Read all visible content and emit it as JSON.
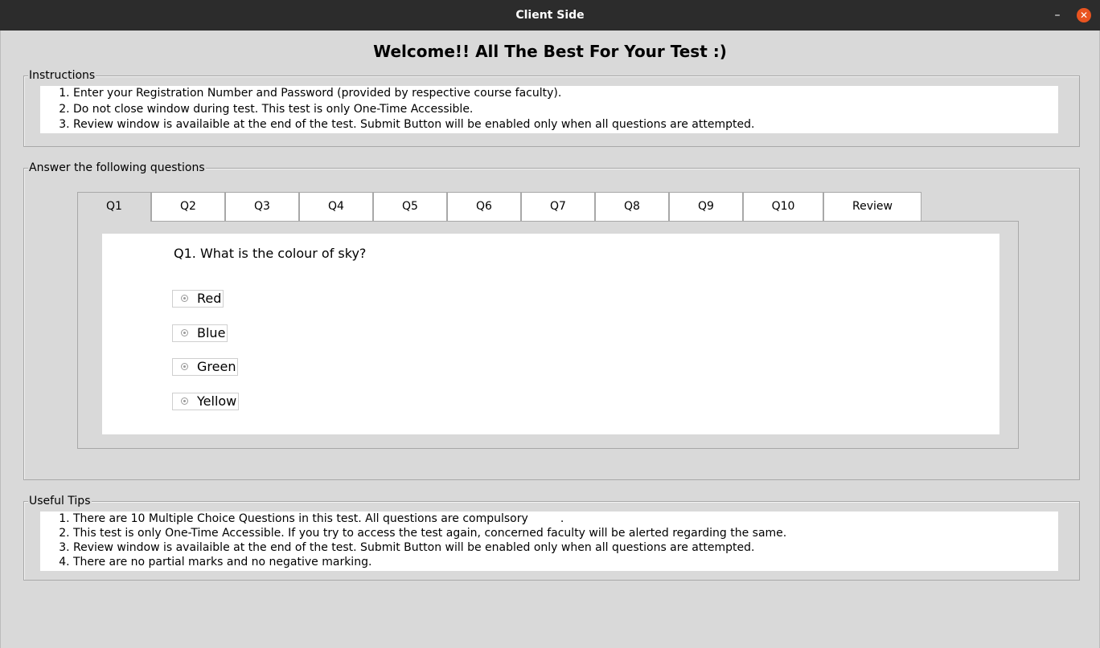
{
  "window": {
    "title": "Client Side",
    "minimize_glyph": "–",
    "close_glyph": "✕",
    "accent_close": "#e95420"
  },
  "welcome": "Welcome!! All The Best For Your Test :)",
  "instructions": {
    "legend": "Instructions",
    "items": [
      "Enter your Registration Number and Password (provided by respective course faculty).",
      "Do not close window during test. This test is only One-Time Accessible.",
      "Review window is availaible at the end of the test. Submit Button will be enabled only when all questions are attempted."
    ]
  },
  "questions": {
    "legend": "Answer the following questions",
    "tabs": [
      "Q1",
      "Q2",
      "Q3",
      "Q4",
      "Q5",
      "Q6",
      "Q7",
      "Q8",
      "Q9",
      "Q10",
      "Review"
    ],
    "active_tab": "Q1",
    "current": {
      "text": "Q1. What is the colour of sky?",
      "options": [
        "Red",
        "Blue",
        "Green",
        "Yellow"
      ]
    }
  },
  "tips": {
    "legend": "Useful Tips",
    "items": [
      "There are 10 Multiple Choice Questions in this test. All questions are compulsory         .",
      "This test is only One-Time Accessible. If you try to access the test again, concerned faculty will be alerted regarding the same.",
      "Review window is availaible at the end of the test. Submit Button will be enabled only when all questions are attempted.",
      "There are no partial marks and no negative marking."
    ]
  }
}
